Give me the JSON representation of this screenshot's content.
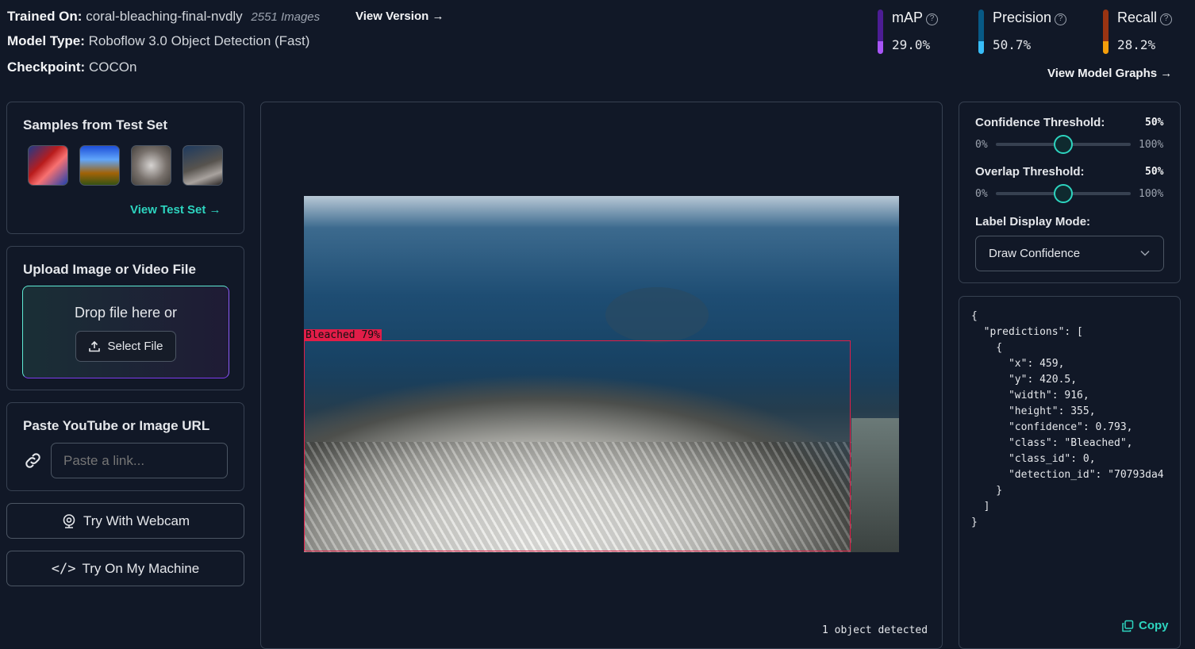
{
  "header": {
    "trained_on_label": "Trained On:",
    "trained_on_value": "coral-bleaching-final-nvdly",
    "image_count": "2551 Images",
    "view_version": "View Version",
    "model_type_label": "Model Type:",
    "model_type_value": "Roboflow 3.0 Object Detection (Fast)",
    "checkpoint_label": "Checkpoint:",
    "checkpoint_value": "COCOn",
    "view_model_graphs": "View Model Graphs"
  },
  "metrics": [
    {
      "name": "mAP",
      "value": "29.0%",
      "color_top": "#4c1d95",
      "color_bottom": "#a855f7"
    },
    {
      "name": "Precision",
      "value": "50.7%",
      "color_top": "#075985",
      "color_bottom": "#38bdf8"
    },
    {
      "name": "Recall",
      "value": "28.2%",
      "color_top": "#9a3412",
      "color_bottom": "#f59e0b"
    }
  ],
  "samples": {
    "title": "Samples from Test Set",
    "view_test_set": "View Test Set"
  },
  "upload": {
    "title": "Upload Image or Video File",
    "drop_text": "Drop file here or",
    "select_file": "Select File"
  },
  "url": {
    "title": "Paste YouTube or Image URL",
    "placeholder": "Paste a link..."
  },
  "buttons": {
    "webcam": "Try With Webcam",
    "machine": "Try On My Machine"
  },
  "preview": {
    "label": "Bleached 79%",
    "status": "1 object detected",
    "box_color": "#e11d48"
  },
  "settings": {
    "confidence_label": "Confidence Threshold:",
    "confidence_value": "50%",
    "confidence_level": 0.5,
    "overlap_label": "Overlap Threshold:",
    "overlap_value": "50%",
    "overlap_level": 0.5,
    "min": "0%",
    "max": "100%",
    "label_mode_label": "Label Display Mode:",
    "label_mode_value": "Draw Confidence"
  },
  "output": {
    "json_text": "{\n  \"predictions\": [\n    {\n      \"x\": 459,\n      \"y\": 420.5,\n      \"width\": 916,\n      \"height\": 355,\n      \"confidence\": 0.793,\n      \"class\": \"Bleached\",\n      \"class_id\": 0,\n      \"detection_id\": \"70793da4\n    }\n  ]\n}",
    "copy": "Copy"
  }
}
